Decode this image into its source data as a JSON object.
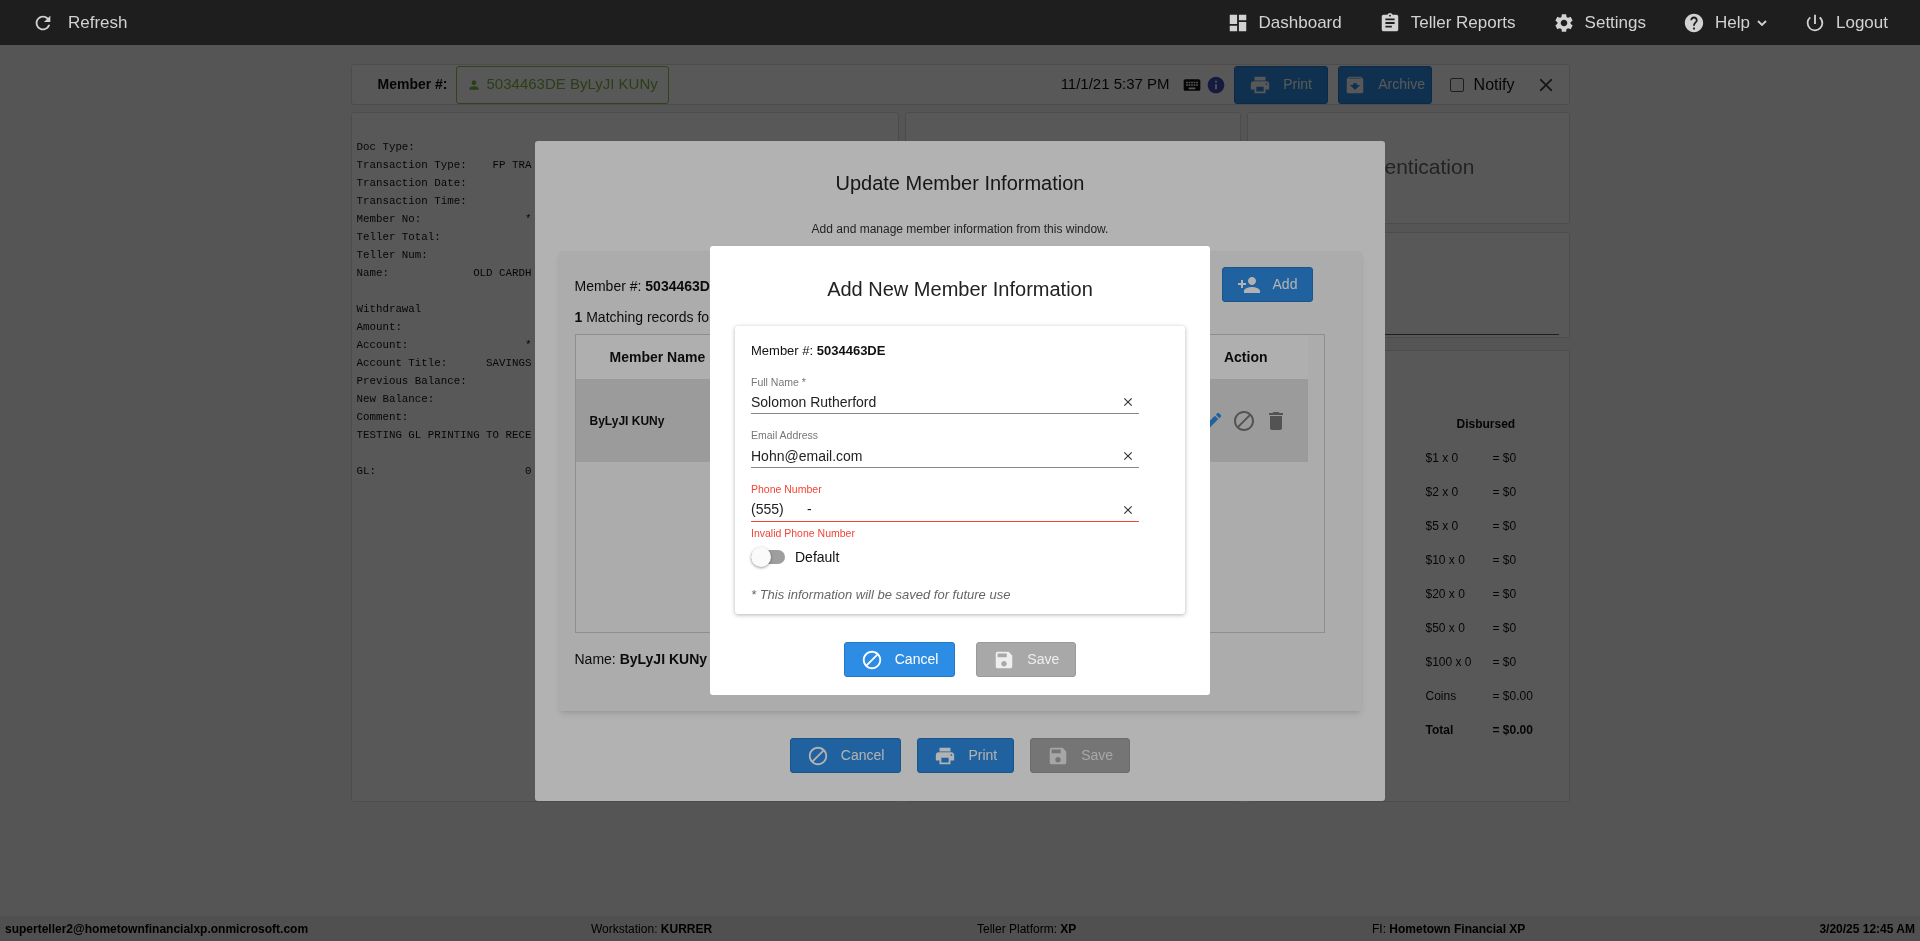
{
  "top_bar": {
    "refresh": "Refresh",
    "items": [
      {
        "kind": "dashboard",
        "label": "Dashboard",
        "dropdown": false
      },
      {
        "kind": "reports",
        "label": "Teller Reports",
        "dropdown": false
      },
      {
        "kind": "settings",
        "label": "Settings",
        "dropdown": false
      },
      {
        "kind": "help",
        "label": "Help",
        "dropdown": true
      },
      {
        "kind": "logout",
        "label": "Logout",
        "dropdown": false
      }
    ]
  },
  "member_bar": {
    "label": "Member #:",
    "member": "5034463DE ByLyJI KUNy",
    "datetime": "11/1/21 5:37 PM",
    "buttons": [
      {
        "kind": "print",
        "label": "Print"
      },
      {
        "kind": "archive",
        "label": "Archive"
      }
    ],
    "notify": {
      "label": "Notify",
      "checked": false
    }
  },
  "receipt": {
    "sections": [
      {
        "lines": [
          "Doc Type:",
          "Transaction Type:    FP TRA",
          "Transaction Date:",
          "Transaction Time:",
          "Member No:                *",
          "Teller Total:",
          "Teller Num:",
          "Name:             OLD CARDH"
        ]
      },
      {
        "lines": [
          "Withdrawal",
          "Amount:",
          "Account:                  *",
          "Account Title:      SAVINGS",
          "Previous Balance:",
          "New Balance:",
          "Comment:",
          "TESTING GL PRINTING TO RECE"
        ]
      },
      {
        "lines": [
          "GL:                       0"
        ]
      }
    ]
  },
  "auth_panel": {
    "title": "entication"
  },
  "disbursed": {
    "title": "Disbursed",
    "rows": [
      {
        "label": "$1 x 0",
        "value": "= $0",
        "total": false
      },
      {
        "label": "$2 x 0",
        "value": "= $0",
        "total": false
      },
      {
        "label": "$5 x 0",
        "value": "= $0",
        "total": false
      },
      {
        "label": "$10 x 0",
        "value": "= $0",
        "total": false
      },
      {
        "label": "$20 x 0",
        "value": "= $0",
        "total": false
      },
      {
        "label": "$50 x 0",
        "value": "= $0",
        "total": false
      },
      {
        "label": "$100 x 0",
        "value": "= $0",
        "total": false
      },
      {
        "label": "Coins",
        "value": "= $0.00",
        "total": false
      },
      {
        "label": "Total",
        "value": "= $0.00",
        "total": true
      }
    ]
  },
  "update_dialog": {
    "title": "Update Member Information",
    "subtitle": "Add and manage member information from this window.",
    "member": "Member #: **5034463D**",
    "matches": "**1** Matching records fo",
    "add_button": "Add",
    "table": {
      "columns": [
        "Member Name",
        "Action"
      ],
      "rows": [
        {
          "name": "ByLyJI KUNy"
        }
      ]
    },
    "name": "Name: **ByLyJI KUNy**",
    "buttons": [
      {
        "kind": "cancel",
        "label": "Cancel",
        "disabled": false
      },
      {
        "kind": "print",
        "label": "Print",
        "disabled": false
      },
      {
        "kind": "save",
        "label": "Save",
        "disabled": true
      }
    ]
  },
  "add_dialog": {
    "title": "Add New Member Information",
    "member": "Member #: **5034463DE**",
    "fields": [
      {
        "label": "Full Name *",
        "value": "Solomon Rutherford",
        "error": false
      },
      {
        "label": "Email Address",
        "value": "Hohn@email.com",
        "error": false
      },
      {
        "label": "Phone Number",
        "value": "(555)      -",
        "error": true,
        "message": "Invalid Phone Number"
      }
    ],
    "toggle": {
      "label": "Default",
      "on": false
    },
    "note": "* This information will be saved for future use",
    "buttons": [
      {
        "kind": "cancel",
        "label": "Cancel",
        "disabled": false
      },
      {
        "kind": "save",
        "label": "Save",
        "disabled": true
      }
    ]
  },
  "status_bar": {
    "user": "superteller2@hometownfinancialxp.onmicrosoft.com",
    "fields": [
      {
        "label": "Workstation:",
        "value": "KURRER"
      },
      {
        "label": "Teller Platform:",
        "value": "XP"
      },
      {
        "label": "FI:",
        "value": "Hometown Financial XP"
      }
    ],
    "time": "3/20/25 12:45 AM"
  }
}
